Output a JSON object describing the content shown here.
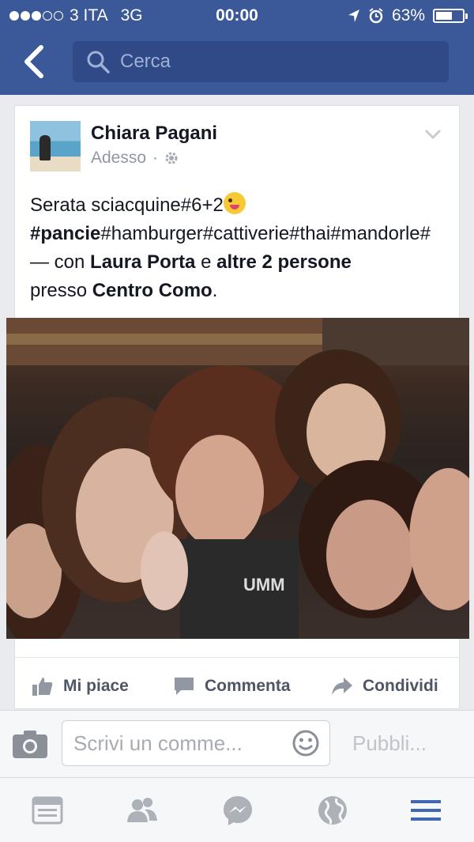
{
  "status_bar": {
    "carrier": "3 ITA",
    "network": "3G",
    "time": "00:00",
    "battery": "63%",
    "battery_level": 0.63,
    "signal_bars_filled": 3,
    "signal_bars_total": 5
  },
  "nav": {
    "search_placeholder": "Cerca"
  },
  "post": {
    "author": "Chiara Pagani",
    "timestamp": "Adesso",
    "separator": "·",
    "text_line1": "Serata sciacquine#6+2",
    "hash_bold": "#pancie",
    "hash_rest": "#hamburger#cattiverie#thai#mandorle#",
    "with_sep": " — con ",
    "tag1": "Laura Porta",
    "conj": " e ",
    "tag2": "altre 2 persone",
    "location_pre": "presso ",
    "location": "Centro Como",
    "end": ".",
    "photo_text": "UMM"
  },
  "actions": {
    "like": "Mi piace",
    "comment": "Commenta",
    "share": "Condividi"
  },
  "comment_bar": {
    "placeholder": "Scrivi un comme...",
    "publish": "Pubbli..."
  },
  "tabs": [
    "news-feed-icon",
    "friends-icon",
    "messenger-icon",
    "globe-icon",
    "menu-icon"
  ],
  "colors": {
    "brand": "#3b5998",
    "active_tab": "#4267b2",
    "inactive_tab": "#adb1b8"
  }
}
